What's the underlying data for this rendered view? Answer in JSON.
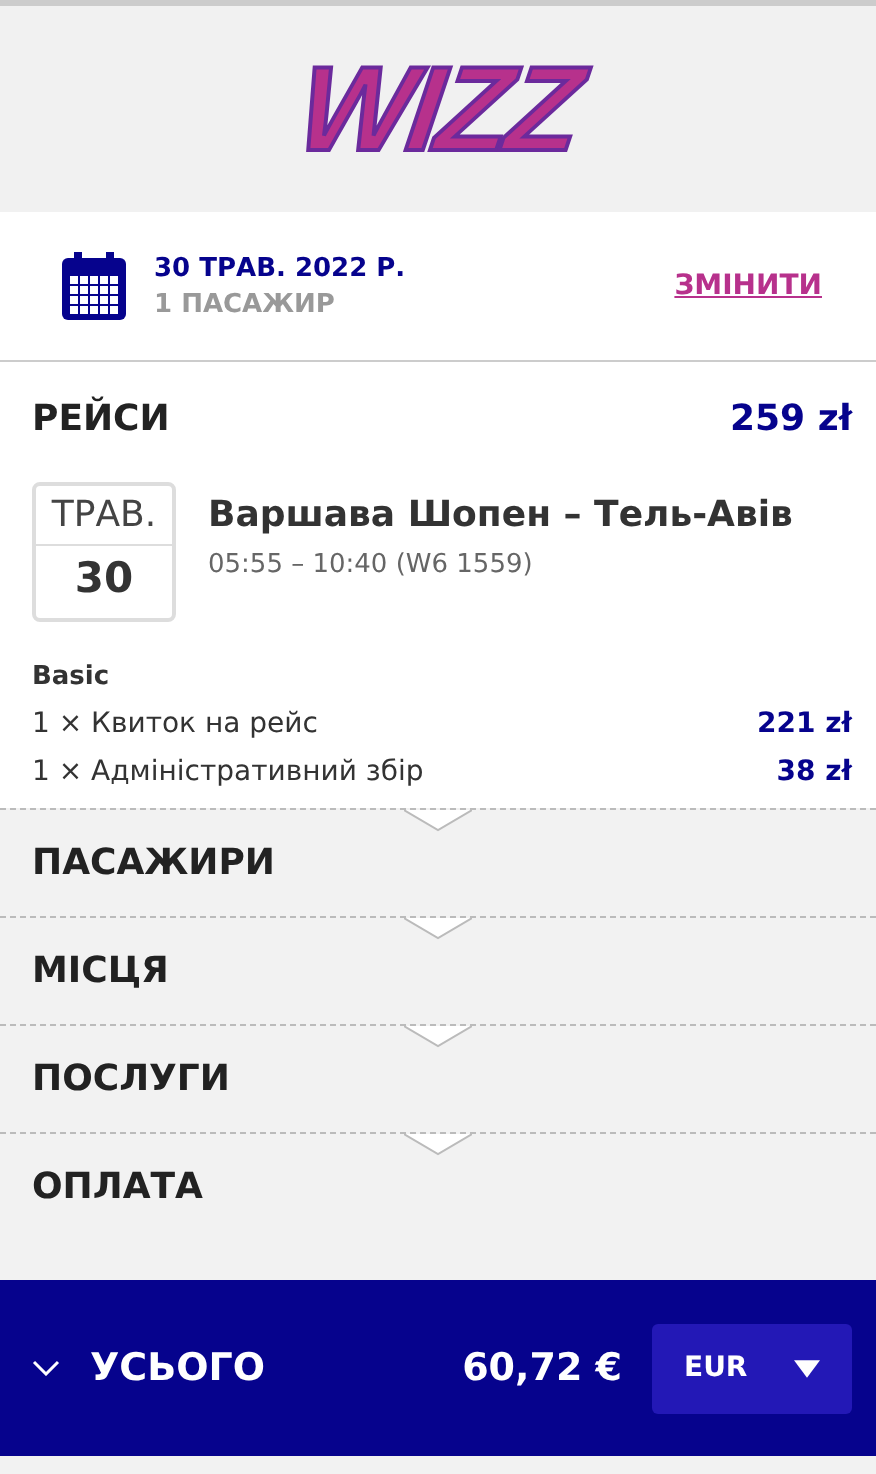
{
  "logo": "WIZZ",
  "booking": {
    "date": "30 ТРАВ. 2022 Р.",
    "passengers": "1 ПАСАЖИР",
    "change_link": "ЗМІНИТИ"
  },
  "flights": {
    "title": "РЕЙСИ",
    "total": "259 zł",
    "month": "ТРАВ.",
    "day": "30",
    "route": "Варшава Шопен – Тель-Авів",
    "times": "05:55 – 10:40 (W6 1559)",
    "fare": "Basic",
    "items": [
      {
        "label": "1 × Квиток на рейс",
        "price": "221 zł"
      },
      {
        "label": "1 × Адміністративний збір",
        "price": "38 zł"
      }
    ]
  },
  "sections": [
    {
      "title": "ПАСАЖИРИ"
    },
    {
      "title": "МІСЦЯ"
    },
    {
      "title": "ПОСЛУГИ"
    },
    {
      "title": "ОПЛАТА"
    }
  ],
  "footer": {
    "label": "УСЬОГО",
    "amount": "60,72 €",
    "currency": "EUR"
  }
}
